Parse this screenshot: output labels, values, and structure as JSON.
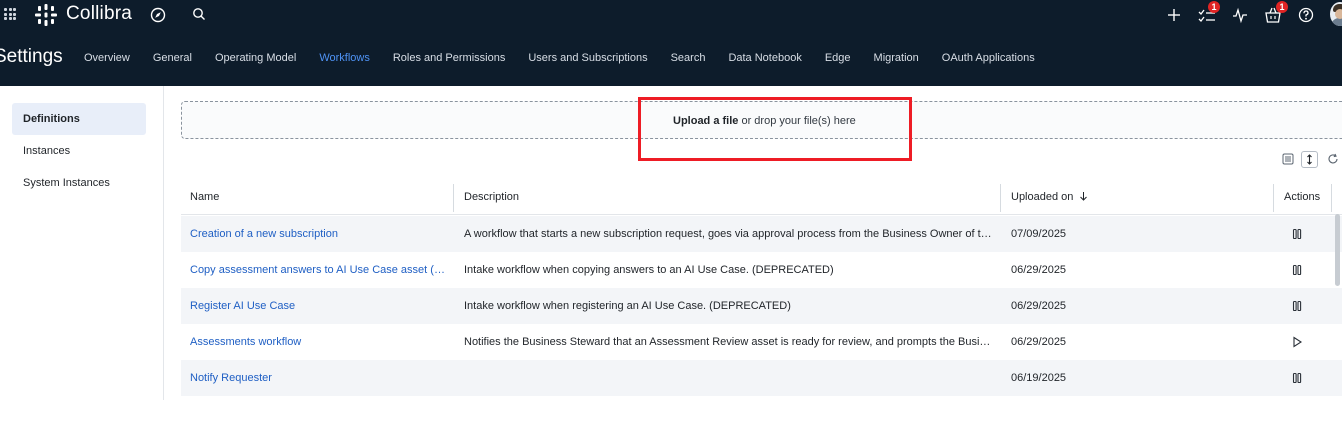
{
  "topbar": {
    "app_name": "Collibra",
    "icons": [
      "app-grid-icon",
      "collibra-logo-icon",
      "compass-icon",
      "search-icon",
      "plus-icon",
      "tasks-icon",
      "activity-icon",
      "basket-icon",
      "help-icon"
    ],
    "tasks_badge": "1",
    "basket_badge": "1"
  },
  "settings": {
    "title": "Settings",
    "tabs": [
      {
        "label": "Overview"
      },
      {
        "label": "General"
      },
      {
        "label": "Operating Model"
      },
      {
        "label": "Workflows",
        "active": true
      },
      {
        "label": "Roles and Permissions"
      },
      {
        "label": "Users and Subscriptions"
      },
      {
        "label": "Search"
      },
      {
        "label": "Data Notebook"
      },
      {
        "label": "Edge"
      },
      {
        "label": "Migration"
      },
      {
        "label": "OAuth Applications"
      }
    ]
  },
  "sidebar": {
    "items": [
      {
        "label": "Definitions",
        "active": true
      },
      {
        "label": "Instances"
      },
      {
        "label": "System Instances"
      }
    ]
  },
  "upload": {
    "link_label": "Upload a file",
    "rest_label": " or drop your file(s) here"
  },
  "table": {
    "columns": {
      "name": "Name",
      "description": "Description",
      "uploaded_on": "Uploaded on",
      "actions": "Actions"
    },
    "rows": [
      {
        "name": "Creation of a new subscription",
        "description": "A workflow that starts a new subscription request, goes via approval process from the Business Owner of th...",
        "uploaded_on": "07/09/2025",
        "action": "pause-icon"
      },
      {
        "name": "Copy assessment answers to AI Use Case asset (D...",
        "description": "Intake workflow when copying answers to an AI Use Case. (DEPRECATED)",
        "uploaded_on": "06/29/2025",
        "action": "pause-icon"
      },
      {
        "name": "Register AI Use Case",
        "description": "Intake workflow when registering an AI Use Case. (DEPRECATED)",
        "uploaded_on": "06/29/2025",
        "action": "pause-icon"
      },
      {
        "name": "Assessments workflow",
        "description": "Notifies the Business Steward that an Assessment Review asset is ready for review, and prompts the Busine...",
        "uploaded_on": "06/29/2025",
        "action": "play-icon"
      },
      {
        "name": "Notify Requester",
        "description": "",
        "uploaded_on": "06/19/2025",
        "action": "pause-icon"
      }
    ]
  },
  "colors": {
    "topbar_bg": "#0d1c2b",
    "active_tab": "#4f93f5",
    "link": "#1f5fc4",
    "badge": "#e02424",
    "highlight": "#ee1c25"
  }
}
